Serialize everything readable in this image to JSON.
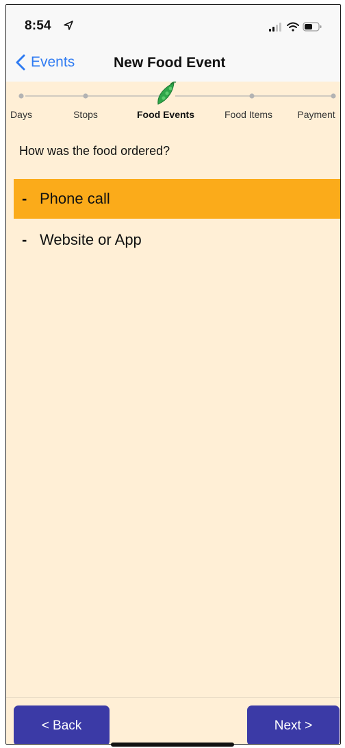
{
  "status_bar": {
    "time": "8:54",
    "location_icon": "location-arrow-icon",
    "signal_icon": "cellular-signal-icon",
    "wifi_icon": "wifi-icon",
    "battery_icon": "battery-icon"
  },
  "nav": {
    "back_label": "Events",
    "title": "New Food Event",
    "accent_color": "#2f7bf2"
  },
  "stepper": {
    "steps": [
      {
        "label": "Days"
      },
      {
        "label": "Stops"
      },
      {
        "label": "Food Events"
      },
      {
        "label": "Food Items"
      },
      {
        "label": "Payment"
      }
    ],
    "current_step": "Food Events",
    "current_icon": "pea-pod-icon"
  },
  "question": {
    "text": "How was the food ordered?"
  },
  "options": [
    {
      "dash": "-",
      "label": "Phone call",
      "selected": true
    },
    {
      "dash": "-",
      "label": "Website or App",
      "selected": false
    }
  ],
  "footer": {
    "back_label": "< Back",
    "next_label": "Next >",
    "button_color": "#3b3aa6"
  },
  "colors": {
    "background": "#ffefd6",
    "selected_option": "#fbab1a"
  }
}
